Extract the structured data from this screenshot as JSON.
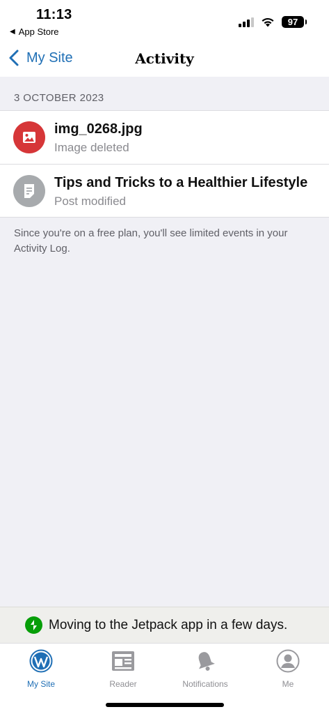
{
  "status_bar": {
    "time": "11:13",
    "back_app": "App Store",
    "battery": "97"
  },
  "nav": {
    "back_label": "My Site",
    "title": "Activity"
  },
  "section": {
    "date": "3 OCTOBER 2023"
  },
  "activities": [
    {
      "title": "img_0268.jpg",
      "subtitle": "Image deleted",
      "icon": "image-icon",
      "icon_color": "#d63638"
    },
    {
      "title": "Tips and Tricks to a Healthier Lifestyle",
      "subtitle": "Post modified",
      "icon": "post-icon",
      "icon_color": "#a7aaad"
    }
  ],
  "footer_note": "Since you're on a free plan, you'll see limited events in your Activity Log.",
  "jetpack_banner": {
    "text": "Moving to the Jetpack app in a few days.",
    "icon": "jetpack-icon",
    "color": "#069e08"
  },
  "tabs": [
    {
      "label": "My Site",
      "icon": "wordpress-icon",
      "active": true
    },
    {
      "label": "Reader",
      "icon": "reader-icon",
      "active": false
    },
    {
      "label": "Notifications",
      "icon": "bell-icon",
      "active": false
    },
    {
      "label": "Me",
      "icon": "profile-icon",
      "active": false
    }
  ],
  "colors": {
    "accent": "#1f6fb5",
    "background": "#f0f0f5",
    "inactive": "#8e8e93"
  }
}
